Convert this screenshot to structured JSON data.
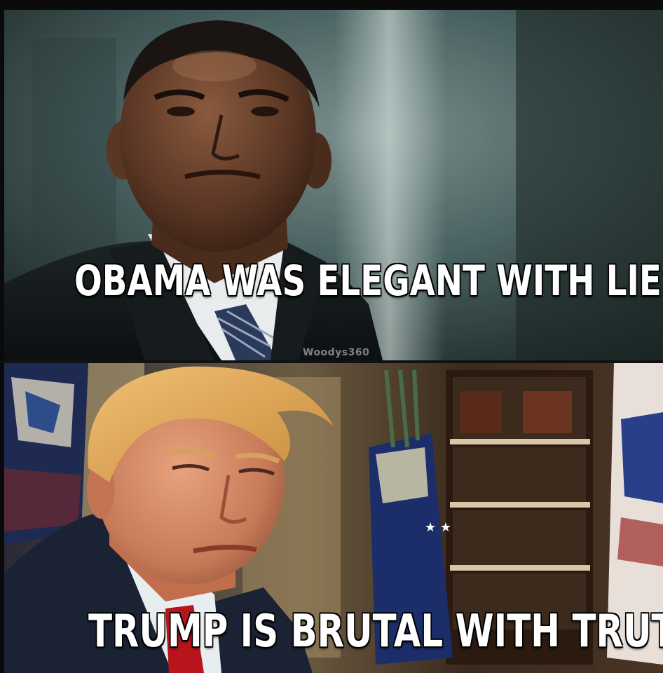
{
  "meme": {
    "top_caption": "OBAMA WAS ELEGANT WITH LIES",
    "bottom_caption": "TRUMP IS BRUTAL WITH TRUTH",
    "watermark": "Woodys360"
  },
  "colors": {
    "top_background": "#3f5a5c",
    "bottom_background": "#3a2a1e",
    "caption_text": "#ffffff"
  }
}
